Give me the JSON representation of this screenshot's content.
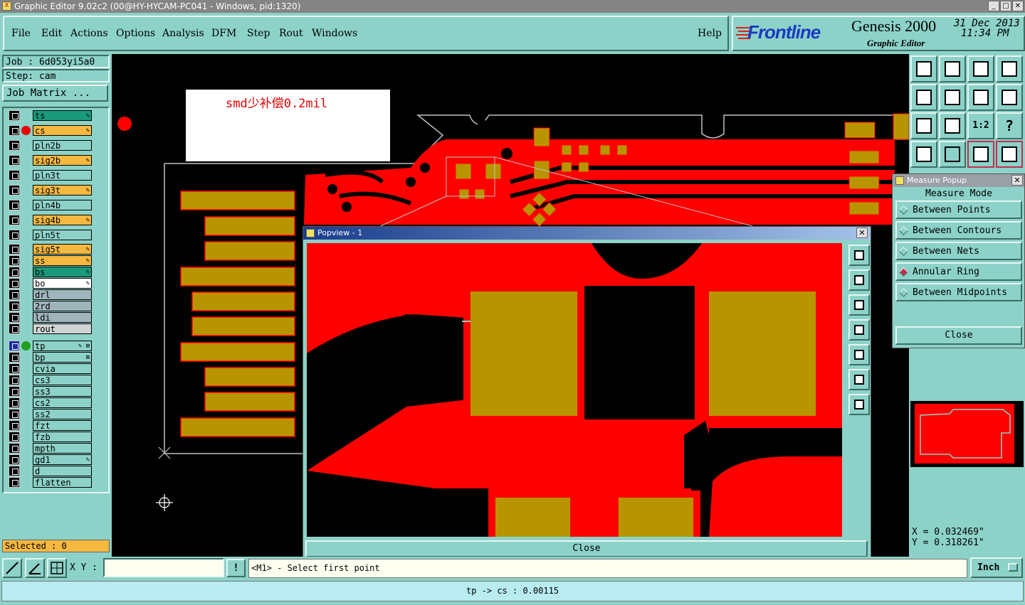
{
  "window": {
    "title": "Graphic Editor 9.02c2 (00@HY-HYCAM-PC041 - Windows, pid:1320)",
    "app_icon": "X",
    "min": "_",
    "max": "□",
    "close": "✕"
  },
  "menu": {
    "items": [
      "File",
      "Edit",
      "Actions",
      "Options",
      "Analysis",
      "DFM",
      "Step",
      "Rout",
      "Windows"
    ],
    "help": "Help"
  },
  "brand": {
    "logo": "Frontline",
    "product": "Genesis 2000",
    "subtitle": "Graphic Editor",
    "date": "31 Dec 2013",
    "time": "11:34 PM"
  },
  "job": {
    "job_line": "Job : 6d053yi5a0",
    "step_line": "Step: cam",
    "matrix_button": "Job Matrix ..."
  },
  "layers": [
    {
      "name": "ts",
      "color": "#1a9a7a",
      "mark": "✎",
      "dot": ""
    },
    {
      "name": "cs",
      "color": "#f5b840",
      "mark": "✎",
      "dot": "#e80000"
    },
    {
      "name": "pln2b",
      "color": "#8cd2c8",
      "mark": "",
      "dot": ""
    },
    {
      "name": "sig2b",
      "color": "#f5b840",
      "mark": "✎",
      "dot": ""
    },
    {
      "name": "pln3t",
      "color": "#8cd2c8",
      "mark": "",
      "dot": ""
    },
    {
      "name": "sig3t",
      "color": "#f5b840",
      "mark": "✎",
      "dot": ""
    },
    {
      "name": "pln4b",
      "color": "#8cd2c8",
      "mark": "",
      "dot": ""
    },
    {
      "name": "sig4b",
      "color": "#f5b840",
      "mark": "✎",
      "dot": ""
    },
    {
      "name": "pln5t",
      "color": "#8cd2c8",
      "mark": "",
      "dot": ""
    },
    {
      "name": "sig5t",
      "color": "#f5b840",
      "mark": "✎",
      "dot": ""
    },
    {
      "name": "ss",
      "color": "#f5b840",
      "mark": "✎",
      "dot": ""
    },
    {
      "name": "bs",
      "color": "#1a9a7a",
      "mark": "✎",
      "dot": ""
    },
    {
      "name": "bo",
      "color": "#ffffff",
      "mark": "✎",
      "dot": ""
    },
    {
      "name": "drl",
      "color": "#a0b4bc",
      "mark": "",
      "dot": ""
    },
    {
      "name": "2rd",
      "color": "#a0b4bc",
      "mark": "",
      "dot": ""
    },
    {
      "name": "ldi",
      "color": "#a0b4bc",
      "mark": "",
      "dot": ""
    },
    {
      "name": "rout",
      "color": "#d0d4d4",
      "mark": "",
      "dot": ""
    },
    {
      "name": "tp",
      "color": "#8cd2c8",
      "mark": "✎ ⊞",
      "dot": "#20a020"
    },
    {
      "name": "bp",
      "color": "#8cd2c8",
      "mark": "⊞",
      "dot": ""
    },
    {
      "name": "cvia",
      "color": "#8cd2c8",
      "mark": "",
      "dot": ""
    },
    {
      "name": "cs3",
      "color": "#8cd2c8",
      "mark": "",
      "dot": ""
    },
    {
      "name": "ss3",
      "color": "#8cd2c8",
      "mark": "",
      "dot": ""
    },
    {
      "name": "cs2",
      "color": "#8cd2c8",
      "mark": "",
      "dot": ""
    },
    {
      "name": "ss2",
      "color": "#8cd2c8",
      "mark": "",
      "dot": ""
    },
    {
      "name": "fzt",
      "color": "#8cd2c8",
      "mark": "",
      "dot": ""
    },
    {
      "name": "fzb",
      "color": "#8cd2c8",
      "mark": "",
      "dot": ""
    },
    {
      "name": "mpth",
      "color": "#8cd2c8",
      "mark": "",
      "dot": ""
    },
    {
      "name": "gd1",
      "color": "#8cd2c8",
      "mark": "✎",
      "dot": ""
    },
    {
      "name": "d",
      "color": "#8cd2c8",
      "mark": "",
      "dot": ""
    },
    {
      "name": "flatten",
      "color": "#8cd2c8",
      "mark": "",
      "dot": ""
    }
  ],
  "selected": "Selected : 0",
  "annotation": "smd少补偿0.2mil",
  "popview": {
    "title": "Popview - 1",
    "close_x": "✕",
    "close_button": "Close"
  },
  "measure": {
    "title": "Measure Popup",
    "close_x": "✕",
    "header": "Measure Mode",
    "options": [
      "Between Points",
      "Between Contours",
      "Between Nets",
      "Annular Ring",
      "Between Midpoints"
    ],
    "selected": "Annular Ring",
    "close_button": "Close"
  },
  "tools": [
    "1:2",
    "?"
  ],
  "coords": {
    "x": "X = 0.032469\"",
    "y": "Y = 0.318261\""
  },
  "bottom": {
    "xy_label": "X Y :",
    "xy_value": "",
    "warn": "!",
    "prompt": "<M1> - Select first point",
    "units": "Inch",
    "status": "tp -> cs : 0.00115"
  },
  "colors": {
    "copper": "#ff0000",
    "pad": "#b89500",
    "panel": "#8cd2c8"
  }
}
